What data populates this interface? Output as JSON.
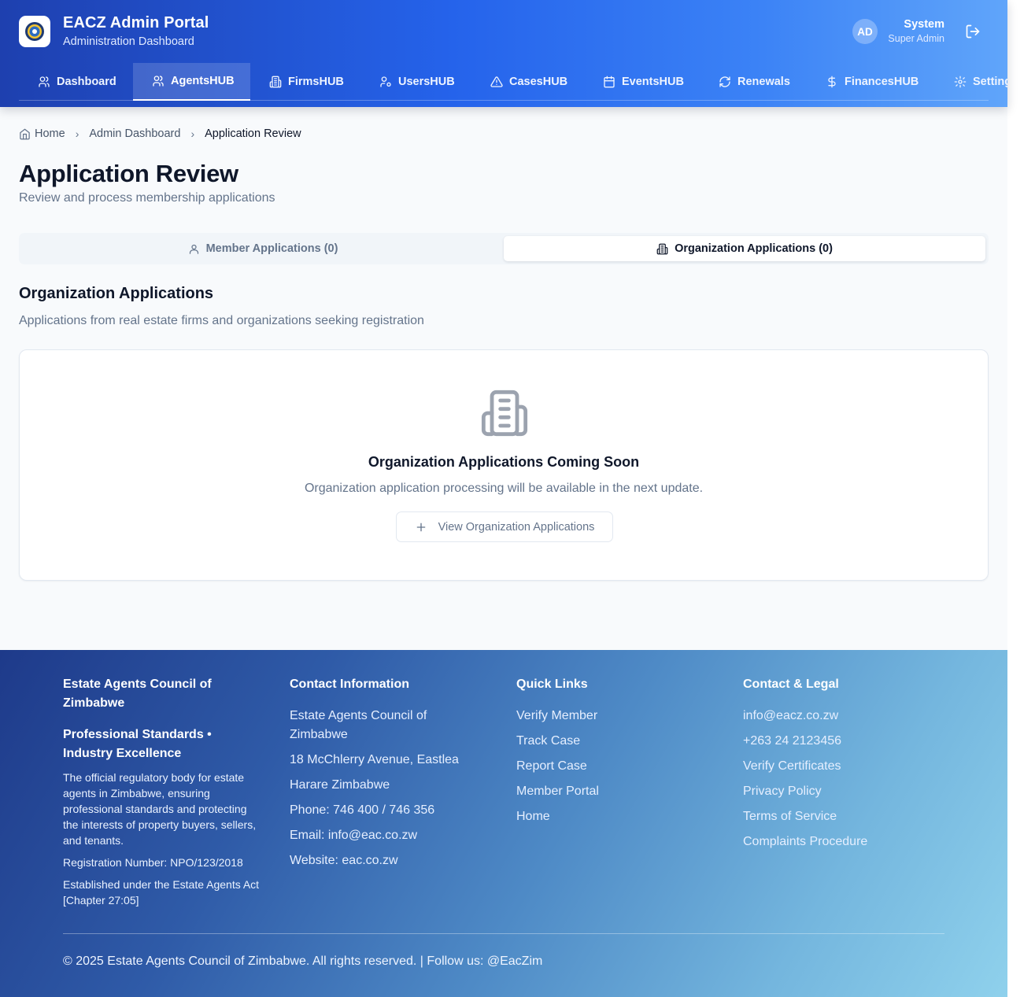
{
  "header": {
    "title": "EACZ Admin Portal",
    "subtitle": "Administration Dashboard",
    "user": {
      "initials": "AD",
      "name": "System",
      "role": "Super Admin"
    }
  },
  "nav": [
    {
      "label": "Dashboard",
      "icon": "users-icon"
    },
    {
      "label": "AgentsHUB",
      "icon": "users-icon",
      "active": true
    },
    {
      "label": "FirmsHUB",
      "icon": "building-icon"
    },
    {
      "label": "UsersHUB",
      "icon": "user-cog-icon"
    },
    {
      "label": "CasesHUB",
      "icon": "alert-triangle-icon"
    },
    {
      "label": "EventsHUB",
      "icon": "calendar-icon"
    },
    {
      "label": "Renewals",
      "icon": "refresh-icon"
    },
    {
      "label": "FinancesHUB",
      "icon": "dollar-icon"
    },
    {
      "label": "Settings",
      "icon": "gear-icon"
    }
  ],
  "breadcrumb": {
    "home": "Home",
    "parent": "Admin Dashboard",
    "current": "Application Review"
  },
  "page": {
    "title": "Application Review",
    "subtitle": "Review and process membership applications"
  },
  "tabs": [
    {
      "label": "Member Applications (0)",
      "icon": "user-icon",
      "active": false
    },
    {
      "label": "Organization Applications (0)",
      "icon": "building-icon",
      "active": true
    }
  ],
  "section": {
    "title": "Organization Applications",
    "subtitle": "Applications from real estate firms and organizations seeking registration"
  },
  "empty_state": {
    "icon": "building-icon",
    "title": "Organization Applications Coming Soon",
    "description": "Organization application processing will be available in the next update.",
    "button_label": "View Organization Applications"
  },
  "footer": {
    "about": {
      "heading": "Estate Agents Council of Zimbabwe",
      "tagline": "Professional Standards • Industry Excellence",
      "description": "The official regulatory body for estate agents in Zimbabwe, ensuring professional standards and protecting the interests of property buyers, sellers, and tenants.",
      "registration": "Registration Number: NPO/123/2018",
      "established": "Established under the Estate Agents Act [Chapter 27:05]"
    },
    "contact": {
      "heading": "Contact Information",
      "lines": [
        "Estate Agents Council of Zimbabwe",
        "18 McChlerry Avenue, Eastlea",
        "Harare Zimbabwe",
        "Phone: 746 400 / 746 356",
        "Email: info@eac.co.zw",
        "Website: eac.co.zw"
      ]
    },
    "quick_links": {
      "heading": "Quick Links",
      "links": [
        "Verify Member",
        "Track Case",
        "Report Case",
        "Member Portal",
        "Home"
      ]
    },
    "legal": {
      "heading": "Contact & Legal",
      "links": [
        "info@eacz.co.zw",
        "+263 24 2123456",
        "Verify Certificates",
        "Privacy Policy",
        "Terms of Service",
        "Complaints Procedure"
      ]
    },
    "copyright": "© 2025 Estate Agents Council of Zimbabwe. All rights reserved. | Follow us: @EacZim"
  },
  "colors": {
    "header_gradient_start": "#1e40af",
    "header_gradient_end": "#60a5fa",
    "footer_gradient_start": "#1e3a8a",
    "footer_gradient_end": "#8fd1ec",
    "text_primary": "#0f172a",
    "text_muted": "#64748b"
  }
}
